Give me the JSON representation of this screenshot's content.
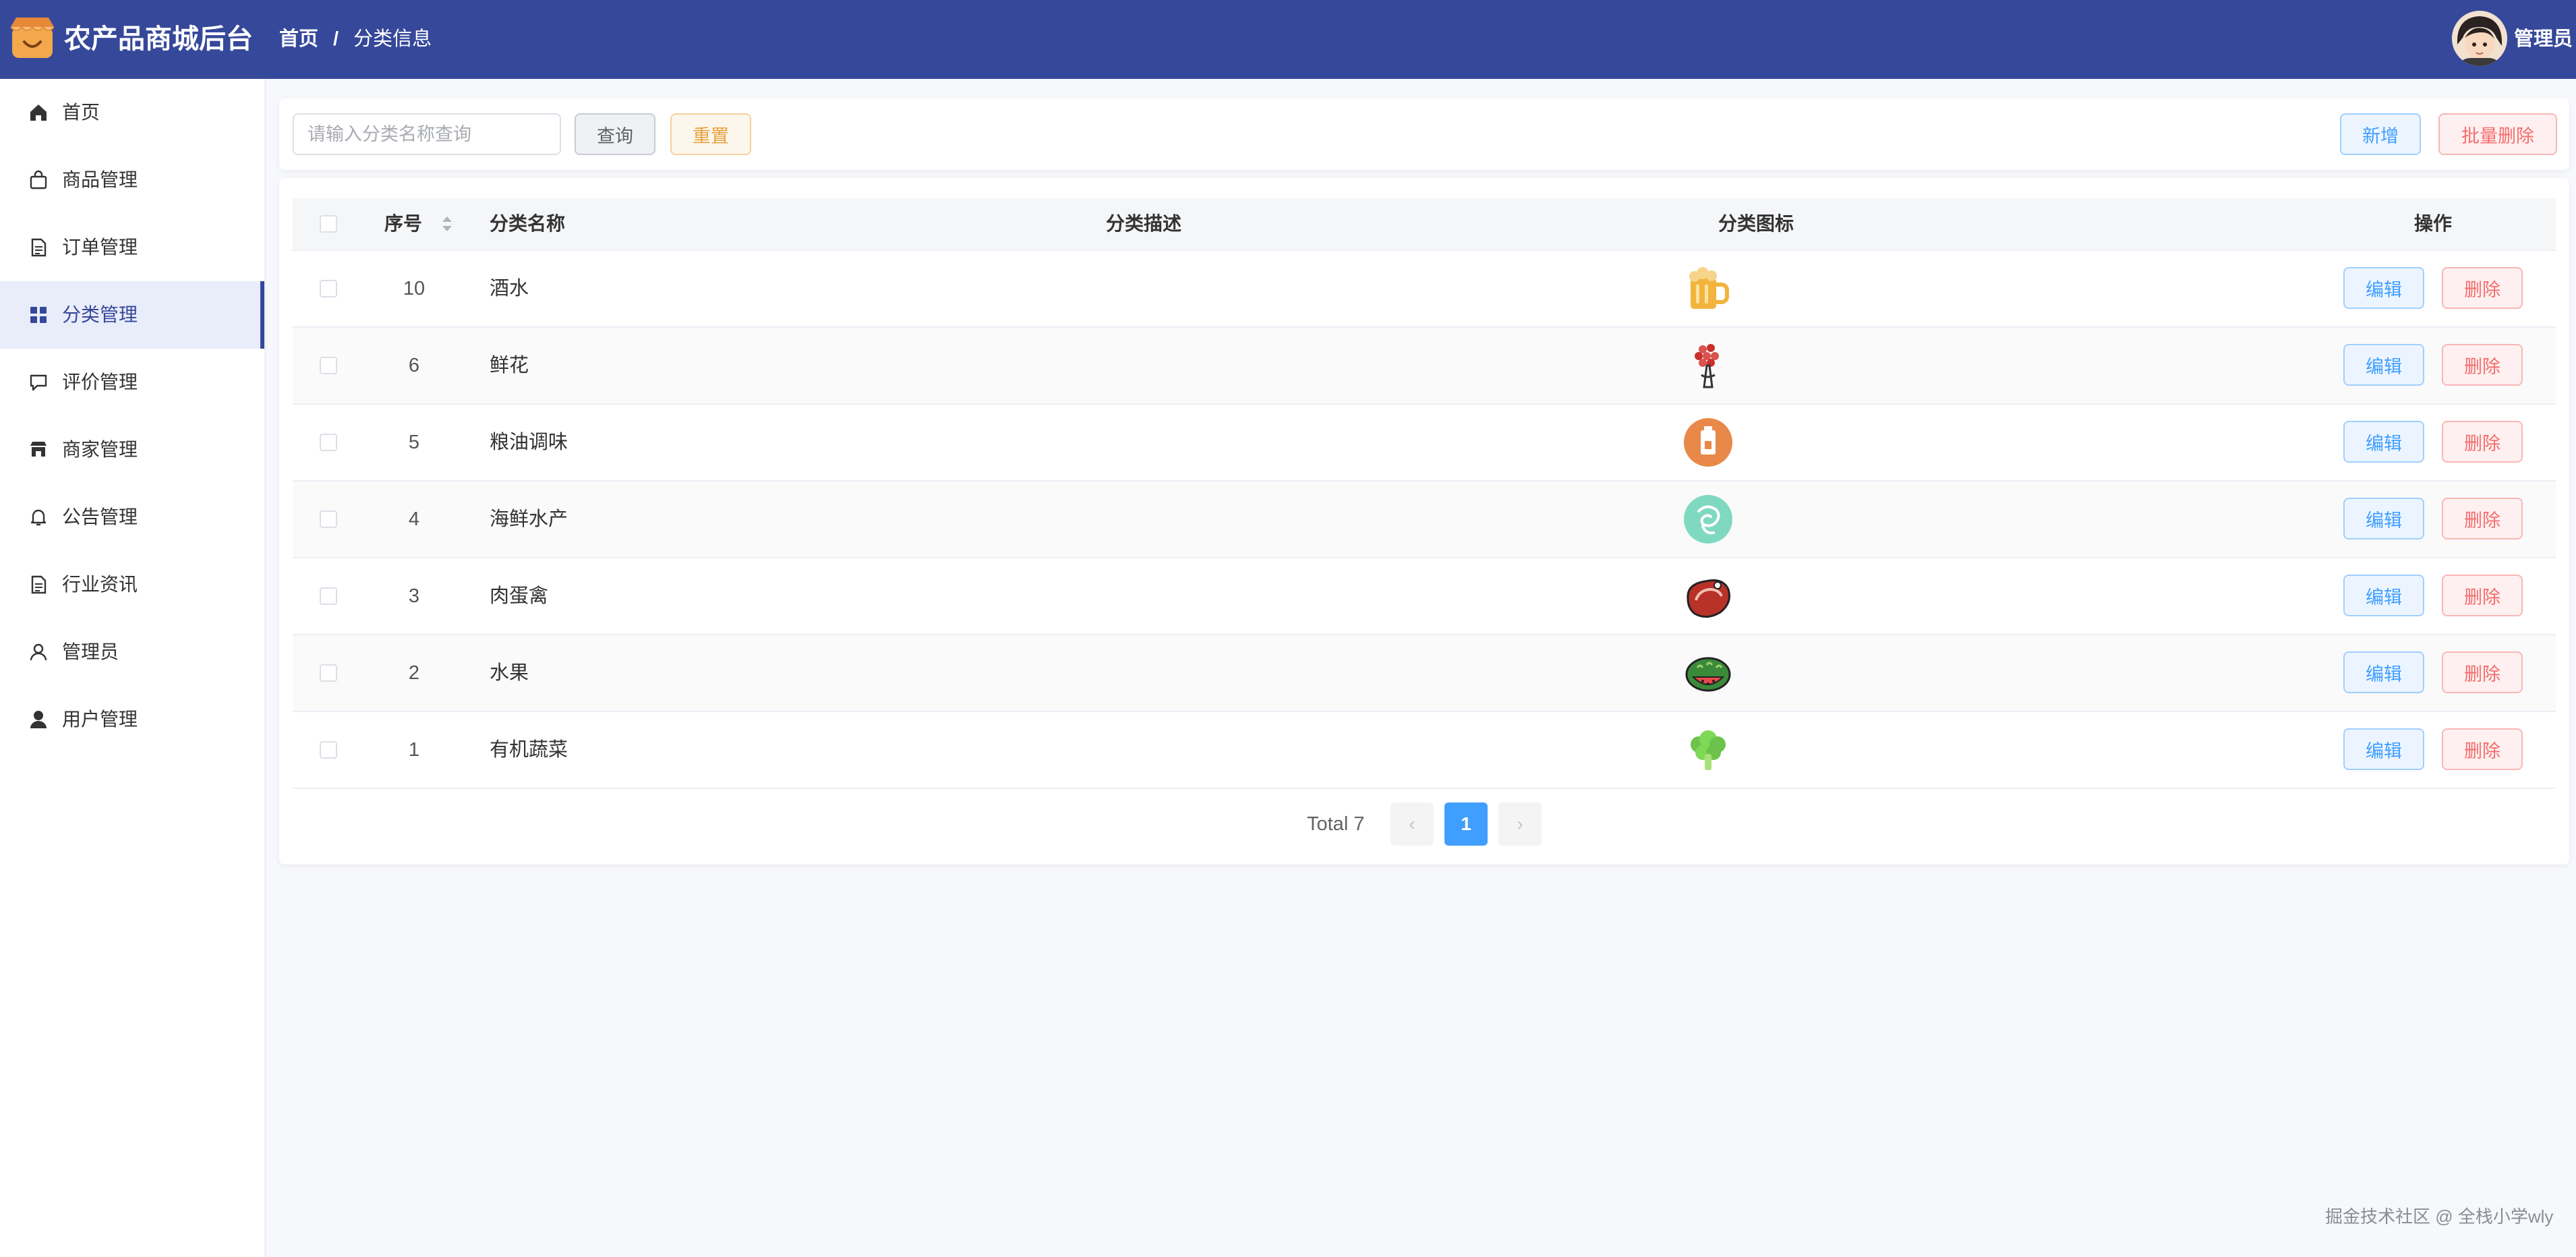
{
  "header": {
    "app_title": "农产品商城后台",
    "breadcrumb": {
      "home": "首页",
      "separator": "/",
      "current": "分类信息"
    },
    "user_name": "管理员"
  },
  "sidebar": {
    "items": [
      {
        "label": "首页",
        "icon": "home-icon",
        "active": false
      },
      {
        "label": "商品管理",
        "icon": "shopping-bag-icon",
        "active": false
      },
      {
        "label": "订单管理",
        "icon": "document-icon",
        "active": false
      },
      {
        "label": "分类管理",
        "icon": "grid-icon",
        "active": true
      },
      {
        "label": "评价管理",
        "icon": "chat-bubble-icon",
        "active": false
      },
      {
        "label": "商家管理",
        "icon": "shop-icon",
        "active": false
      },
      {
        "label": "公告管理",
        "icon": "bell-icon",
        "active": false
      },
      {
        "label": "行业资讯",
        "icon": "document-icon",
        "active": false
      },
      {
        "label": "管理员",
        "icon": "user-outline-icon",
        "active": false
      },
      {
        "label": "用户管理",
        "icon": "user-filled-icon",
        "active": false
      }
    ]
  },
  "toolbar": {
    "search_placeholder": "请输入分类名称查询",
    "search_value": "",
    "query_label": "查询",
    "reset_label": "重置",
    "add_label": "新增",
    "batch_delete_label": "批量删除"
  },
  "table": {
    "columns": {
      "id": "序号",
      "name": "分类名称",
      "description": "分类描述",
      "icon": "分类图标",
      "actions": "操作"
    },
    "edit_label": "编辑",
    "delete_label": "删除",
    "rows": [
      {
        "id": "10",
        "name": "酒水",
        "description": "",
        "icon": "beer-mug-icon"
      },
      {
        "id": "6",
        "name": "鲜花",
        "description": "",
        "icon": "flower-bouquet-icon"
      },
      {
        "id": "5",
        "name": "粮油调味",
        "description": "",
        "icon": "oil-bottle-icon"
      },
      {
        "id": "4",
        "name": "海鲜水产",
        "description": "",
        "icon": "shrimp-icon"
      },
      {
        "id": "3",
        "name": "肉蛋禽",
        "description": "",
        "icon": "steak-icon"
      },
      {
        "id": "2",
        "name": "水果",
        "description": "",
        "icon": "watermelon-icon"
      },
      {
        "id": "1",
        "name": "有机蔬菜",
        "description": "",
        "icon": "broccoli-icon"
      }
    ]
  },
  "pagination": {
    "total_text": "Total 7",
    "current_page": "1",
    "prev_symbol": "‹",
    "next_symbol": "›"
  },
  "watermark": "掘金技术社区 @ 全栈小学wly",
  "colors": {
    "header_bg": "#36489a",
    "sidebar_active_bg": "#e9edfa",
    "primary": "#409eff",
    "danger": "#f56c6c",
    "warning": "#e6a23c"
  }
}
